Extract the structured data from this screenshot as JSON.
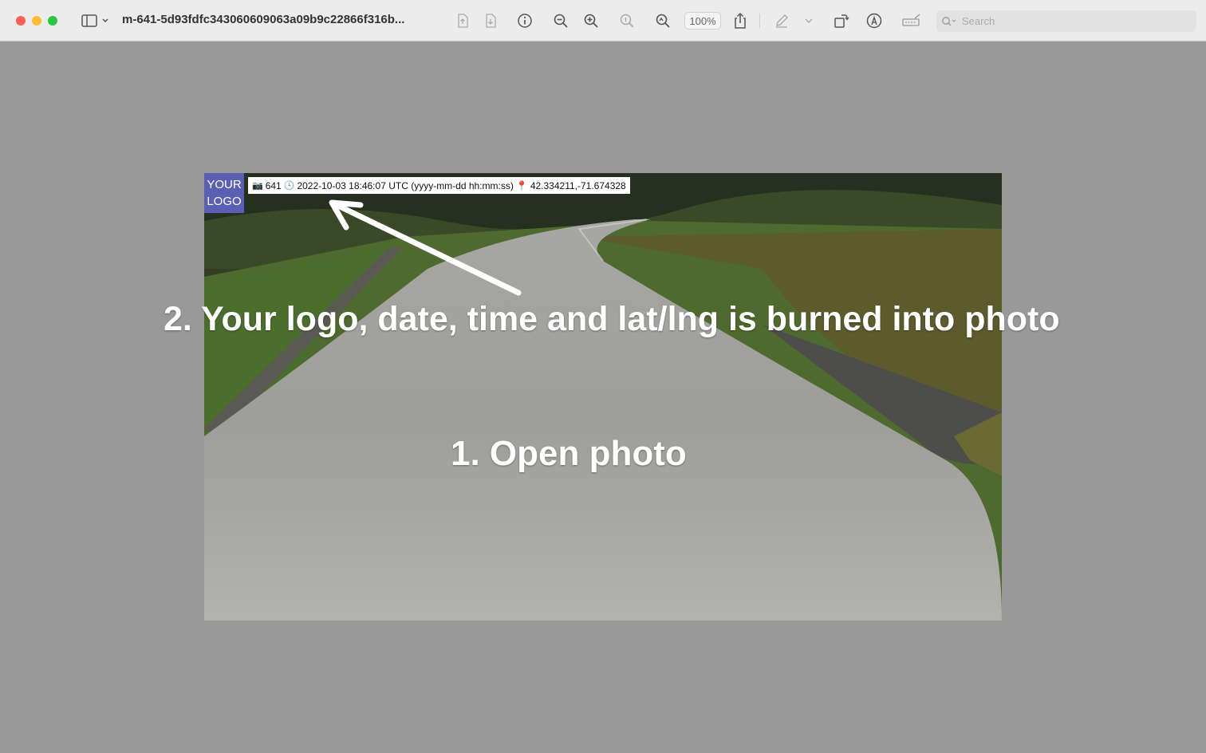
{
  "window": {
    "title": "m-641-5d93fdfc343060609063a09b9c22866f316b...",
    "zoom_label": "100%",
    "search_placeholder": "Search"
  },
  "icons": {
    "sidebar_toggle": "sidebar-icon",
    "info": "info-icon",
    "zoom_out": "zoom-out-icon",
    "zoom_in": "zoom-in-icon",
    "share": "share-icon",
    "markup": "pencil-icon",
    "rotate": "rotate-icon",
    "annotate": "markup-circle-icon",
    "signature": "signature-icon"
  },
  "photo": {
    "logo_line1": "YOUR",
    "logo_line2": "LOGO",
    "stamp": {
      "id": "641",
      "datetime": "2022-10-03 18:46:07 UTC (yyyy-mm-dd hh:mm:ss)",
      "latlng": "42.334211,-71.674328"
    }
  },
  "annotations": {
    "step2": "2. Your logo, date, time and lat/lng is burned into photo",
    "step1": "1. Open photo"
  },
  "colors": {
    "logo_bg": "#5b5fb4",
    "background": "#999999"
  }
}
